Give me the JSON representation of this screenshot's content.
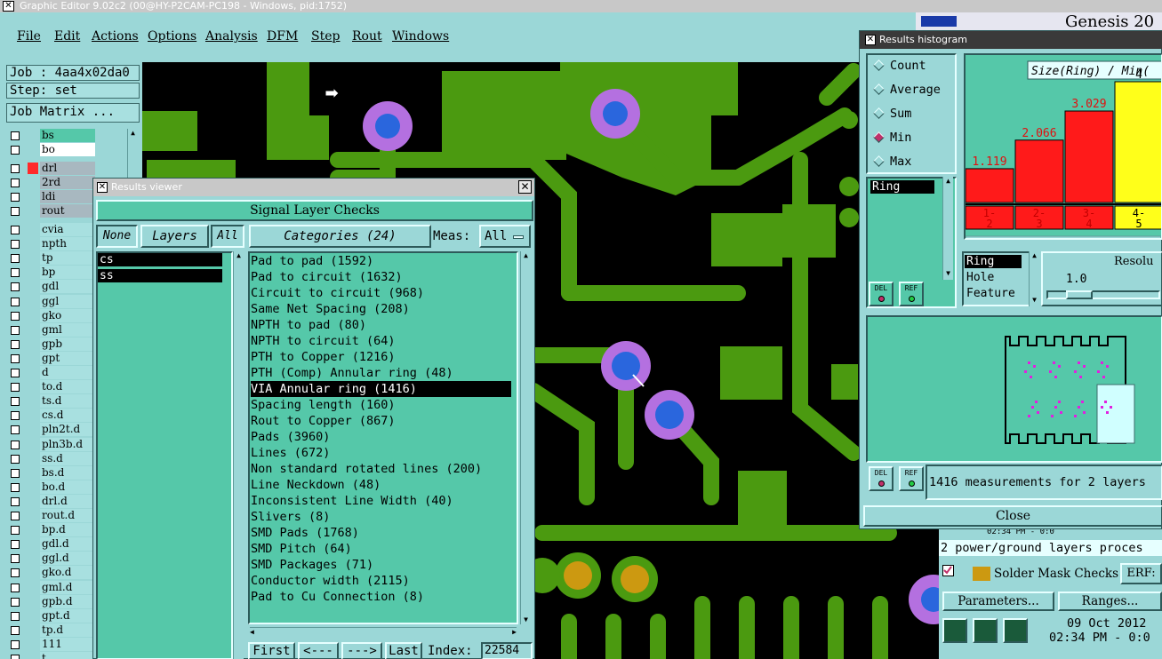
{
  "window": {
    "title": "Graphic Editor 9.02c2 (00@HY-P2CAM-PC198 - Windows, pid:1752)"
  },
  "menu": [
    "File",
    "Edit",
    "Actions",
    "Options",
    "Analysis",
    "DFM",
    "Step",
    "Rout",
    "Windows"
  ],
  "job": {
    "job_label": "Job : 4aa4x02da0",
    "step_label": "Step: set",
    "matrix_button": "Job Matrix ..."
  },
  "layers": [
    "bs",
    "bo",
    "drl",
    "2rd",
    "ldi",
    "rout",
    "cvia",
    "npth",
    "tp",
    "bp",
    "gdl",
    "ggl",
    "gko",
    "gml",
    "gpb",
    "gpt",
    "d",
    "to.d",
    "ts.d",
    "cs.d",
    "pln2t.d",
    "pln3b.d",
    "ss.d",
    "bs.d",
    "bo.d",
    "drl.d",
    "rout.d",
    "bp.d",
    "gdl.d",
    "ggl.d",
    "gko.d",
    "gml.d",
    "gpb.d",
    "gpt.d",
    "tp.d",
    "111",
    "t"
  ],
  "results_viewer": {
    "title": "Results viewer",
    "header": "Signal Layer Checks",
    "none_button": "None",
    "layers_button": "Layers",
    "all_button": "All",
    "categories_button": "Categories (24)",
    "meas_label": "Meas:",
    "meas_value": "All",
    "layer_items": [
      "cs",
      "ss"
    ],
    "categories": [
      "Pad to pad (1592)",
      "Pad to circuit (1632)",
      "Circuit to circuit (968)",
      "Same Net Spacing (208)",
      "NPTH to pad (80)",
      "NPTH to circuit (64)",
      "PTH to Copper (1216)",
      "PTH (Comp) Annular ring (48)",
      "VIA Annular ring (1416)",
      "Spacing length (160)",
      "Rout to Copper (867)",
      "Pads (3960)",
      "Lines (672)",
      "Non standard rotated lines (200)",
      "Line Neckdown (48)",
      "Inconsistent Line Width (40)",
      "Slivers (8)",
      "SMD Pads (1768)",
      "SMD Pitch (64)",
      "SMD Packages (71)",
      "Conductor width (2115)",
      "Pad to Cu Connection (8)"
    ],
    "selected_index": 8,
    "nav": {
      "first": "First",
      "prev": "<---",
      "next": "--->",
      "last": "Last",
      "index_label": "Index:",
      "index_value": "22584"
    }
  },
  "results_histogram": {
    "title": "Results histogram",
    "modes": [
      "Count",
      "Average",
      "Sum",
      "Min",
      "Max"
    ],
    "selected_mode": "Min",
    "measure_list": [
      "Ring"
    ],
    "del_label": "DEL",
    "ref_label": "REF",
    "chart_title": "Size(Ring) / Min(",
    "param_list": [
      "Ring",
      "Hole",
      "Feature"
    ],
    "resolution_label": "Resolu",
    "resolution_value": "1.0",
    "status": "1416 measurements for 2 layers",
    "close": "Close"
  },
  "chart_data": {
    "type": "bar",
    "title": "Size(Ring) / Min(",
    "categories": [
      "1-2",
      "2-3",
      "3-4",
      "4-5"
    ],
    "values": [
      1.119,
      2.066,
      3.029,
      4
    ],
    "value_labels": [
      "1.119",
      "2.066",
      "3.029",
      "4"
    ],
    "colors": [
      "#ff1a1a",
      "#ff1a1a",
      "#ff1a1a",
      "#ffff1a"
    ],
    "ylim": [
      0,
      4
    ]
  },
  "background": {
    "genesis_title": "Genesis 20",
    "power_text": "2 power/ground layers proces",
    "solder_mask": "Solder Mask Checks",
    "erf": "ERF:",
    "parameters": "Parameters...",
    "ranges": "Ranges...",
    "date": "09 Oct 2012",
    "time": "02:34 PM - 0:0",
    "time2": "02:34 PM - 0:0"
  },
  "colors": {
    "panel": "#9bd7d7",
    "list": "#55c8a9",
    "copper": "#4b9a10",
    "pad": "#b470e0",
    "pad_core": "#2a66dd",
    "via_gold": "#cc9911"
  }
}
